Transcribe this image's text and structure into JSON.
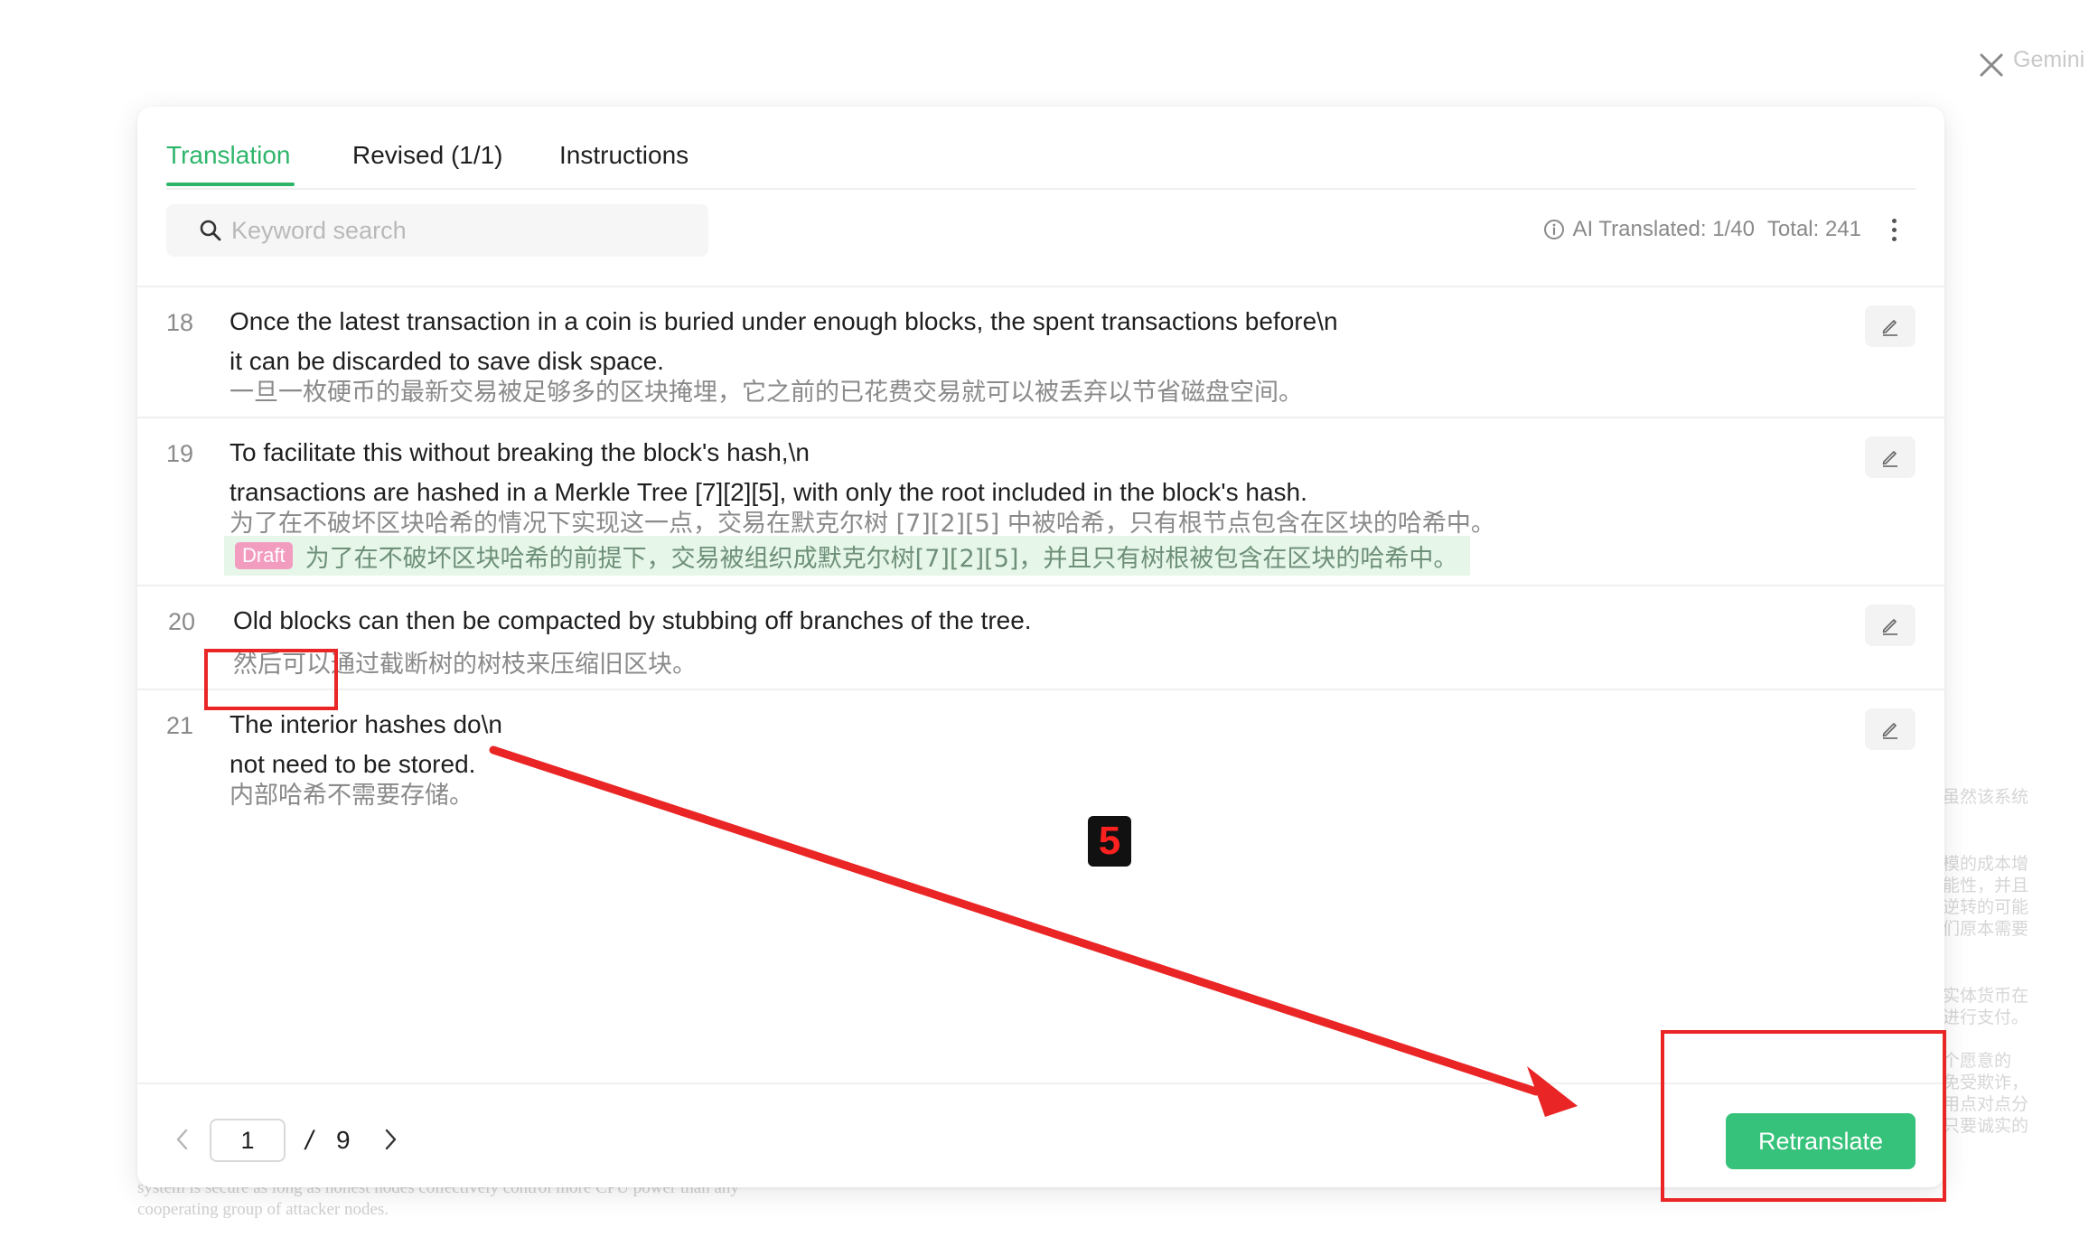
{
  "overlay": {
    "close_label": "Close",
    "side_app_label": "Gemini"
  },
  "tabs": [
    {
      "label": "Translation",
      "active": true
    },
    {
      "label": "Revised (1/1)",
      "active": false
    },
    {
      "label": "Instructions",
      "active": false
    }
  ],
  "search": {
    "placeholder": "Keyword search",
    "value": ""
  },
  "stats": {
    "ai_translated": "AI Translated: 1/40",
    "total": "Total: 241"
  },
  "segments": [
    {
      "num": "18",
      "source_lines": [
        "Once the latest transaction in a coin is buried under enough blocks, the spent transactions before\\n",
        "it can be discarded to save disk space."
      ],
      "translation": "一旦一枚硬币的最新交易被足够多的区块掩埋，它之前的已花费交易就可以被丢弃以节省磁盘空间。"
    },
    {
      "num": "19",
      "source_lines": [
        "To facilitate this without breaking the block's hash,\\n",
        "transactions are hashed in a Merkle Tree [7][2][5], with only the root included in the block's hash."
      ],
      "translation": "为了在不破坏区块哈希的情况下实现这一点，交易在默克尔树 [7][2][5] 中被哈希，只有根节点包含在区块的哈希中。",
      "draft_badge": "Draft",
      "draft_text": "为了在不破坏区块哈希的前提下，交易被组织成默克尔树[7][2][5]，并且只有树根被包含在区块的哈希中。"
    },
    {
      "num": "20",
      "source_lines": [
        "Old blocks can then be compacted by stubbing off branches of the tree."
      ],
      "translation": "然后可以通过截断树的树枝来压缩旧区块。"
    },
    {
      "num": "21",
      "source_lines": [
        "The interior hashes do\\n",
        "not need to be stored."
      ],
      "translation": "内部哈希不需要存储。"
    }
  ],
  "pagination": {
    "current": "1",
    "separator": "/",
    "total": "9"
  },
  "actions": {
    "retranslate": "Retranslate"
  },
  "annotation": {
    "step_number": "5",
    "color": "#ea2525"
  },
  "colors": {
    "accent": "#2fb56a",
    "button": "#36c27a",
    "draft_badge": "#f29cc0",
    "draft_bg": "#e6f7ea"
  },
  "background_text": {
    "bottom_lines": [
      "system is secure as long as honest nodes collectively control more CPU power than any",
      "cooperating group of attacker nodes."
    ],
    "side_lines": [
      "虽然该系统",
      "模的成本增",
      "能性，并且",
      "逆转的可能",
      "们原本需要",
      "实体货币在",
      "进行支付。",
      "个愿意的",
      "免受欺诈，",
      "用点对点分",
      "只要诚实的"
    ]
  }
}
